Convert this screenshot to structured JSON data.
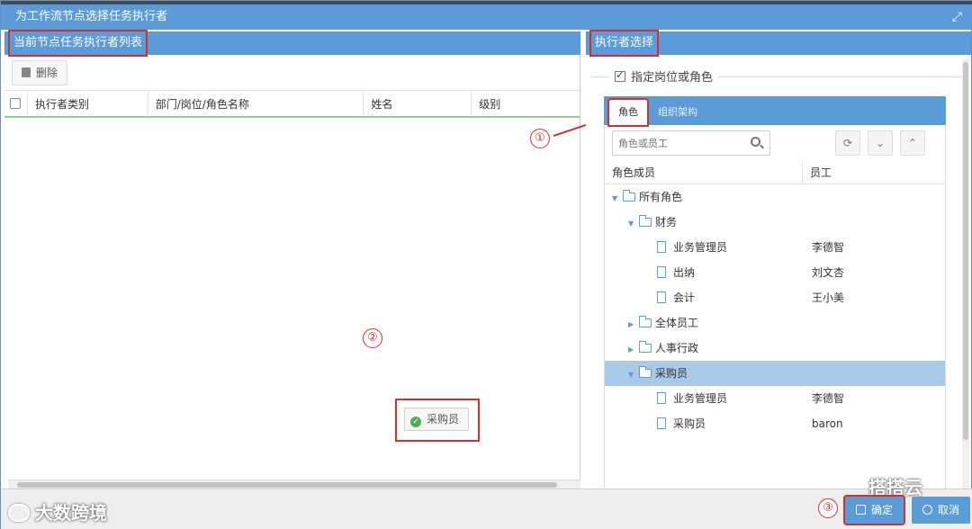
{
  "window": {
    "title": "为工作流节点选择任务执行者"
  },
  "left": {
    "header": "当前节点任务执行者列表",
    "delete_label": "删除",
    "columns": [
      "执行者类别",
      "部门/岗位/角色名称",
      "姓名",
      "级别"
    ],
    "drag_item": "采购员"
  },
  "right": {
    "header": "执行者选择",
    "section_title": "指定岗位或角色",
    "tabs": [
      "角色",
      "组织架构"
    ],
    "search_placeholder": "角色或员工",
    "tree_columns": [
      "角色成员",
      "员工"
    ],
    "tree": [
      {
        "label": "所有角色",
        "employee": ""
      },
      {
        "label": "财务",
        "employee": ""
      },
      {
        "label": "业务管理员",
        "employee": "李德智"
      },
      {
        "label": "出纳",
        "employee": "刘文杏"
      },
      {
        "label": "会计",
        "employee": "王小美"
      },
      {
        "label": "全体员工",
        "employee": ""
      },
      {
        "label": "人事行政",
        "employee": ""
      },
      {
        "label": "采购员",
        "employee": ""
      },
      {
        "label": "业务管理员",
        "employee": "李德智"
      },
      {
        "label": "采购员",
        "employee": "baron"
      }
    ]
  },
  "annotations": [
    "①",
    "②",
    "③"
  ],
  "footer": {
    "ok_label": "确定",
    "cancel_label": "取消"
  },
  "watermarks": [
    "大数跨境",
    "搭搭云"
  ],
  "colors": {
    "accent": "#5a9bd8",
    "highlight": "#d6302b",
    "selected_row": "#a9c9e9"
  }
}
